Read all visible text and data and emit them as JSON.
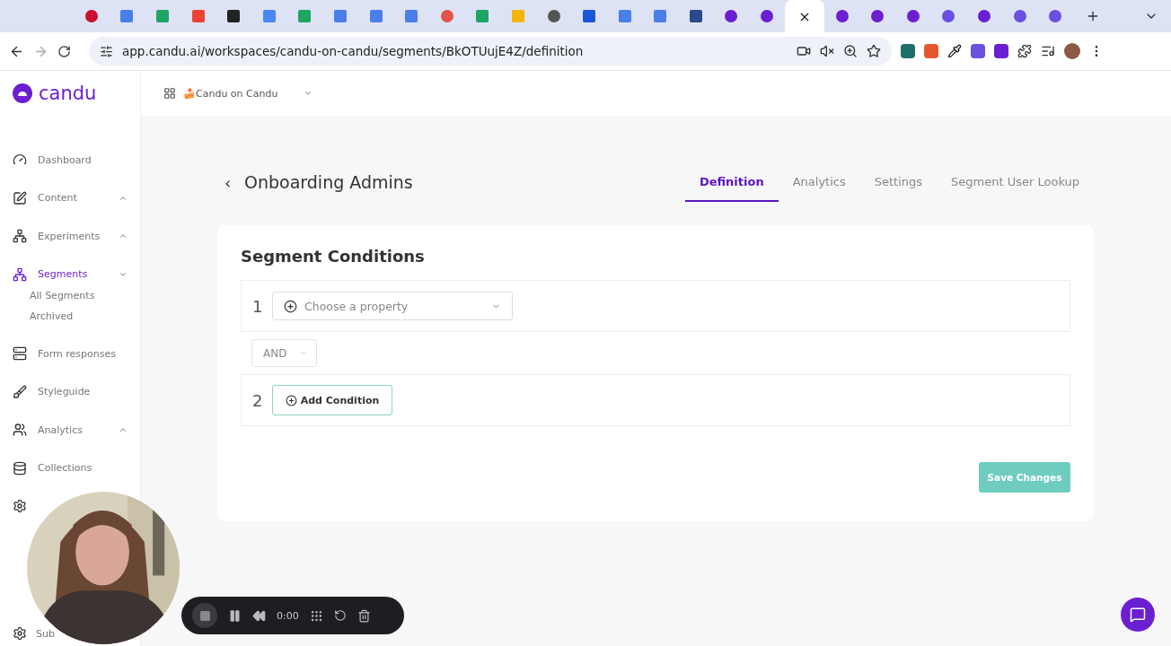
{
  "browser": {
    "tabs": [
      {
        "kind": "record",
        "selected": false
      },
      {
        "kind": "doc",
        "selected": false
      },
      {
        "kind": "sheet",
        "selected": false
      },
      {
        "kind": "mail",
        "selected": false
      },
      {
        "kind": "dark",
        "selected": false
      },
      {
        "kind": "calendar",
        "selected": false
      },
      {
        "kind": "sheet",
        "selected": false
      },
      {
        "kind": "doc",
        "selected": false
      },
      {
        "kind": "doc",
        "selected": false
      },
      {
        "kind": "doc",
        "selected": false
      },
      {
        "kind": "branch",
        "selected": false
      },
      {
        "kind": "sheet",
        "selected": false
      },
      {
        "kind": "slides",
        "selected": false
      },
      {
        "kind": "globe",
        "selected": false
      },
      {
        "kind": "play",
        "selected": false
      },
      {
        "kind": "doc",
        "selected": false
      },
      {
        "kind": "doc",
        "selected": false
      },
      {
        "kind": "bars",
        "selected": false
      },
      {
        "kind": "candu",
        "selected": false
      },
      {
        "kind": "candu",
        "selected": false
      },
      {
        "kind": "close",
        "selected": true,
        "label": "×"
      },
      {
        "kind": "candu",
        "selected": false
      },
      {
        "kind": "candu",
        "selected": false
      },
      {
        "kind": "candu",
        "selected": false
      },
      {
        "kind": "star",
        "selected": false
      },
      {
        "kind": "candu",
        "selected": false
      },
      {
        "kind": "star",
        "selected": false
      },
      {
        "kind": "star",
        "selected": false
      }
    ],
    "url": "app.candu.ai/workspaces/candu-on-candu/segments/BkOTUujE4Z/definition"
  },
  "app": {
    "logo": "candu",
    "workspace": "🍰Candu on Candu"
  },
  "sidebar": {
    "items": [
      {
        "kind": "dashboard",
        "label": "Dashboard",
        "selected": false
      },
      {
        "kind": "content",
        "label": "Content",
        "selected": false,
        "expanded": false
      },
      {
        "kind": "experiments",
        "label": "Experiments",
        "selected": false,
        "expanded": false
      },
      {
        "kind": "segments",
        "label": "Segments",
        "selected": true,
        "expanded": true,
        "children": [
          {
            "label": "All Segments"
          },
          {
            "label": "Archived"
          }
        ]
      },
      {
        "kind": "forms",
        "label": "Form responses",
        "selected": false
      },
      {
        "kind": "styleguide",
        "label": "Styleguide",
        "selected": false
      },
      {
        "kind": "analytics",
        "label": "Analytics",
        "selected": false,
        "expanded": false
      },
      {
        "kind": "collections",
        "label": "Collections",
        "selected": false
      },
      {
        "kind": "settings",
        "selected": false
      },
      {
        "kind": "settings",
        "label": "Sub",
        "selected": false
      }
    ]
  },
  "page": {
    "back": "‹",
    "title": "Onboarding Admins",
    "tabs": [
      {
        "label": "Definition",
        "selected": true
      },
      {
        "label": "Analytics",
        "selected": false
      },
      {
        "label": "Settings",
        "selected": false
      },
      {
        "label": "Segment User Lookup",
        "selected": false
      }
    ],
    "heading": "Segment Conditions",
    "conditions": [
      {
        "number": "1",
        "kind": "select",
        "placeholder": "Choose a property"
      },
      {
        "number": "2",
        "kind": "add",
        "label": "Add Condition"
      }
    ],
    "operator": "AND",
    "save": "Save Changes"
  },
  "recorder": {
    "time": "0:00"
  }
}
